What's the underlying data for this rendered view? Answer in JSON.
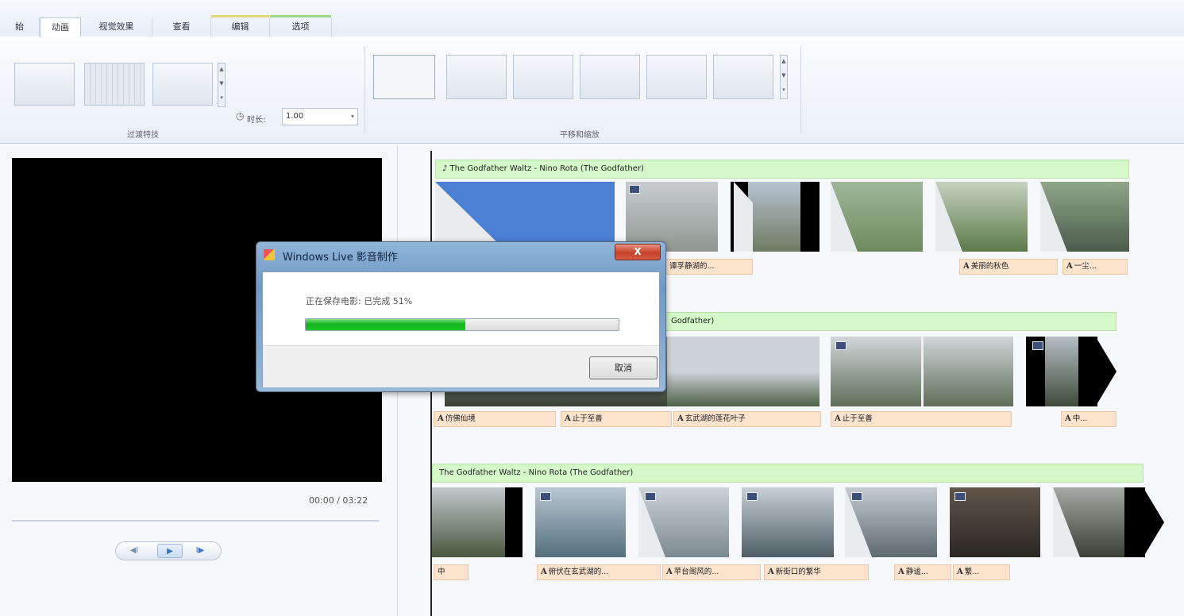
{
  "ribbon": {
    "tabs": [
      {
        "label": "始",
        "active": false
      },
      {
        "label": "动画",
        "active": true
      },
      {
        "label": "视觉效果",
        "active": false
      },
      {
        "label": "查看",
        "active": false
      },
      {
        "label": "编辑",
        "active": false
      },
      {
        "label": "选项",
        "active": false
      }
    ],
    "groups": {
      "transitions_caption": "过渡特技",
      "pan_zoom_caption": "平移和缩放"
    },
    "duration_label": "时长:",
    "duration_value": "1.00"
  },
  "preview": {
    "timecode": "00:00 / 03:22",
    "controls": {
      "prev": "◀I",
      "play": "▶",
      "next": "I▶"
    }
  },
  "storyboard": {
    "rows": [
      {
        "music": "♪ The Godfather Waltz - Nino Rota (The Godfather)",
        "captions": [
          "谭孚静湖的...",
          "美丽的秋色",
          "一尘..."
        ]
      },
      {
        "music": "Godfather)",
        "captions": [
          "仿佛仙境",
          "止于至善",
          "玄武湖的莲花叶子",
          "止于至善",
          "中..."
        ]
      },
      {
        "music": "The Godfather Waltz - Nino Rota (The Godfather)",
        "captions": [
          "中",
          "俯伏在玄武湖的...",
          "苹台阁风的...",
          "新街口的繁华",
          "静谧...",
          "繁..."
        ]
      }
    ]
  },
  "dialog": {
    "title": "Windows Live 影音制作",
    "close_label": "X",
    "status_text": "正在保存电影: 已完成 51%",
    "progress_percent": 51,
    "cancel_label": "取消"
  },
  "colors": {
    "music_bar": "#d4f8c8",
    "caption_bar": "#fbe3cd",
    "progress_green": "#1ac426",
    "accent_blue": "#4a7fd4"
  }
}
